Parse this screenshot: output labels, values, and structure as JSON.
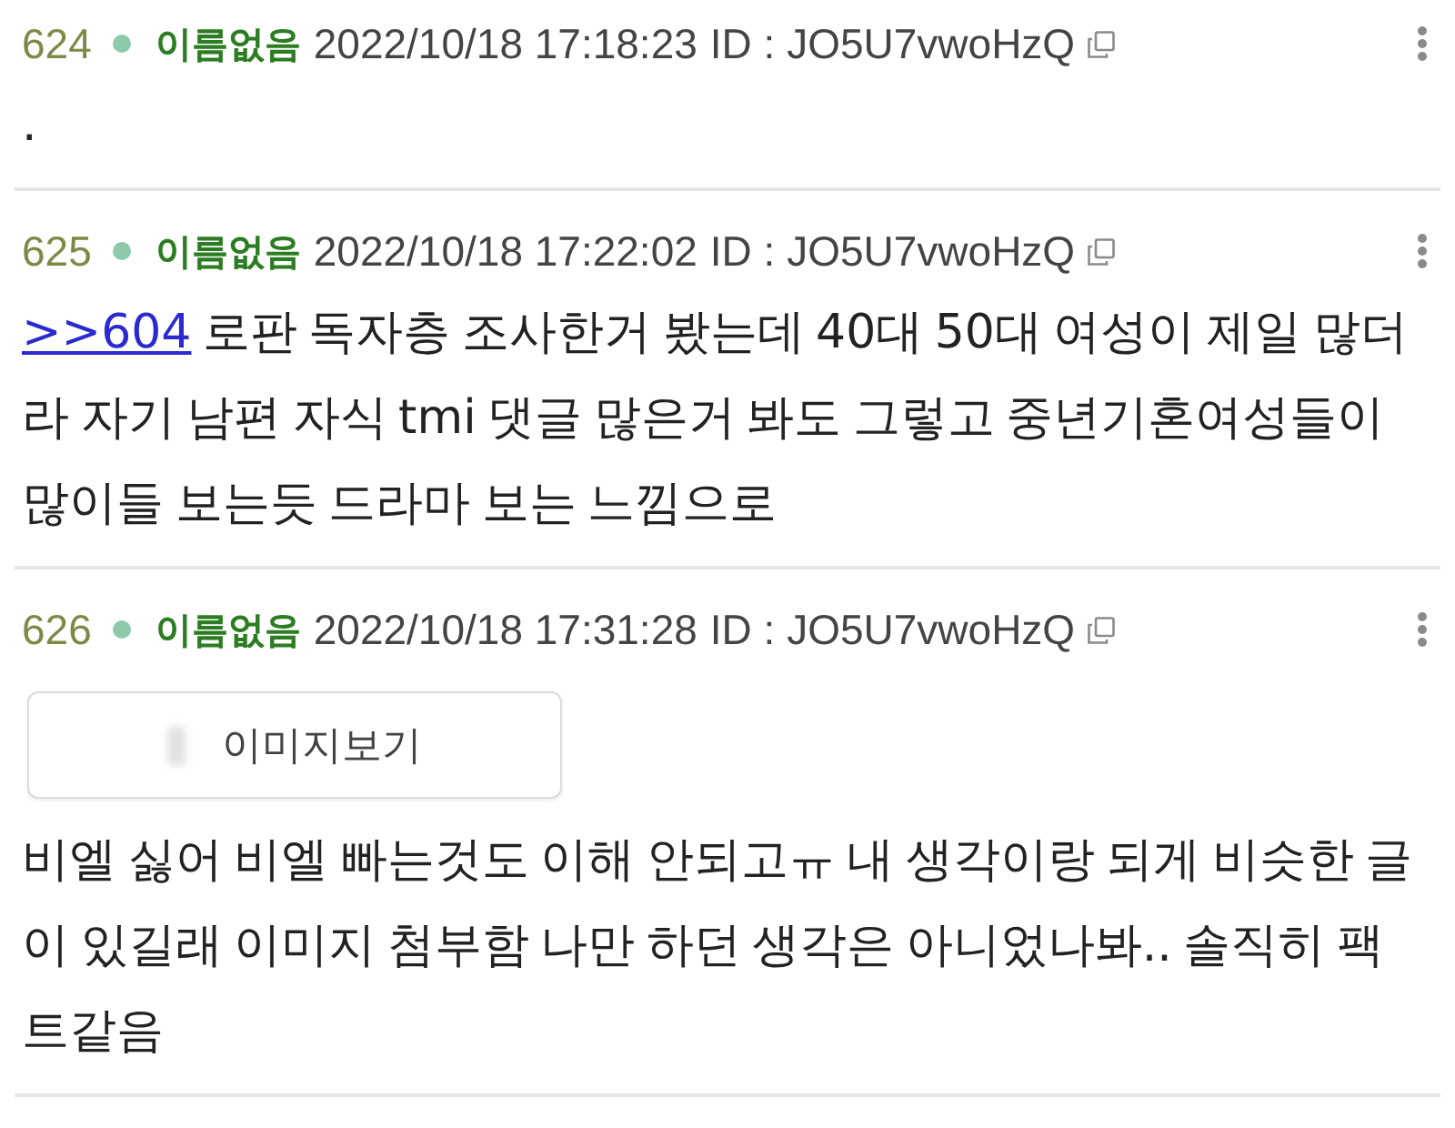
{
  "posts": [
    {
      "number": "624",
      "name": "이름없음",
      "date": "2022/10/18 17:18:23",
      "id": "ID : JO5U7vwoHzQ",
      "text": "."
    },
    {
      "number": "625",
      "name": "이름없음",
      "date": "2022/10/18 17:22:02",
      "id": "ID : JO5U7vwoHzQ",
      "reply_to": ">>604",
      "text": "로판 독자층 조사한거 봤는데 40대 50대 여성이 제일 많더라 자기 남편 자식 tmi 댓글 많은거 봐도 그렇고 중년기혼여성들이 많이들 보는듯 드라마 보는 느낌으로"
    },
    {
      "number": "626",
      "name": "이름없음",
      "date": "2022/10/18 17:31:28",
      "id": "ID : JO5U7vwoHzQ",
      "attachment": {
        "label": "이미지보기"
      },
      "text": "비엘 싫어 비엘 빠는것도 이해 안되고ㅠ 내 생각이랑 되게 비슷한 글이 있길래 이미지 첨부함 나만 하던 생각은 아니었나봐.. 솔직히 팩트같음"
    }
  ]
}
